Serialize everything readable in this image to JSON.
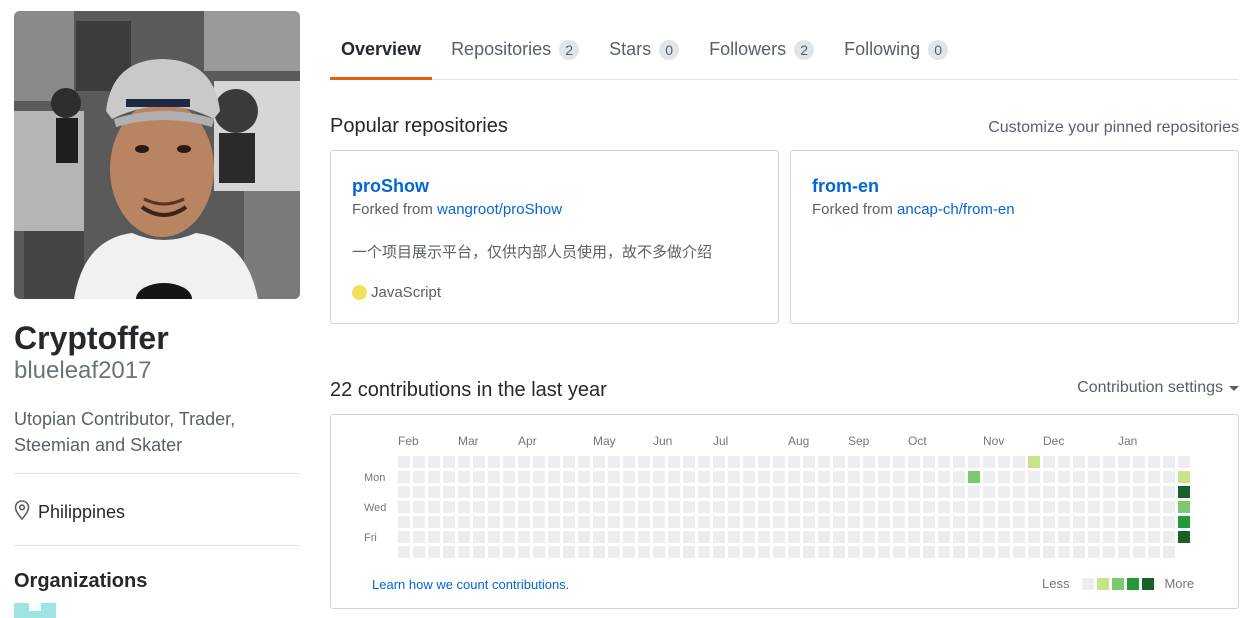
{
  "profile": {
    "fullname": "Cryptoffer",
    "username": "blueleaf2017",
    "bio": "Utopian Contributor, Trader, Steemian and Skater",
    "location": "Philippines",
    "organizations_title": "Organizations"
  },
  "tabs": [
    {
      "label": "Overview",
      "count": null,
      "active": true
    },
    {
      "label": "Repositories",
      "count": "2"
    },
    {
      "label": "Stars",
      "count": "0"
    },
    {
      "label": "Followers",
      "count": "2"
    },
    {
      "label": "Following",
      "count": "0"
    }
  ],
  "popular": {
    "title": "Popular repositories",
    "customize_label": "Customize your pinned repositories",
    "repos": [
      {
        "name": "proShow",
        "forked_prefix": "Forked from",
        "forked_from": "wangroot/proShow",
        "description": "一个项目展示平台，仅供内部人员使用，故不多做介绍",
        "language": "JavaScript",
        "language_color": "#f1e05a"
      },
      {
        "name": "from-en",
        "forked_prefix": "Forked from",
        "forked_from": "ancap-ch/from-en"
      }
    ]
  },
  "contributions": {
    "title": "22 contributions in the last year",
    "settings_label": "Contribution settings",
    "months": [
      "Feb",
      "Mar",
      "Apr",
      "May",
      "Jun",
      "Jul",
      "Aug",
      "Sep",
      "Oct",
      "Nov",
      "Dec",
      "Jan"
    ],
    "day_labels": [
      "Mon",
      "Wed",
      "Fri"
    ],
    "learn_link": "Learn how we count contributions.",
    "legend_less": "Less",
    "legend_more": "More",
    "colors": [
      "#ebedf0",
      "#c6e48b",
      "#7bc96f",
      "#239a3b",
      "#196127"
    ],
    "grid_weeks": 53,
    "last_week_days": 6,
    "cells": [
      {
        "week": 38,
        "day": 1,
        "level": 2
      },
      {
        "week": 42,
        "day": 0,
        "level": 1
      },
      {
        "week": 52,
        "day": 1,
        "level": 1
      },
      {
        "week": 52,
        "day": 2,
        "level": 4
      },
      {
        "week": 52,
        "day": 3,
        "level": 2
      },
      {
        "week": 52,
        "day": 4,
        "level": 3
      },
      {
        "week": 52,
        "day": 5,
        "level": 4
      }
    ]
  }
}
